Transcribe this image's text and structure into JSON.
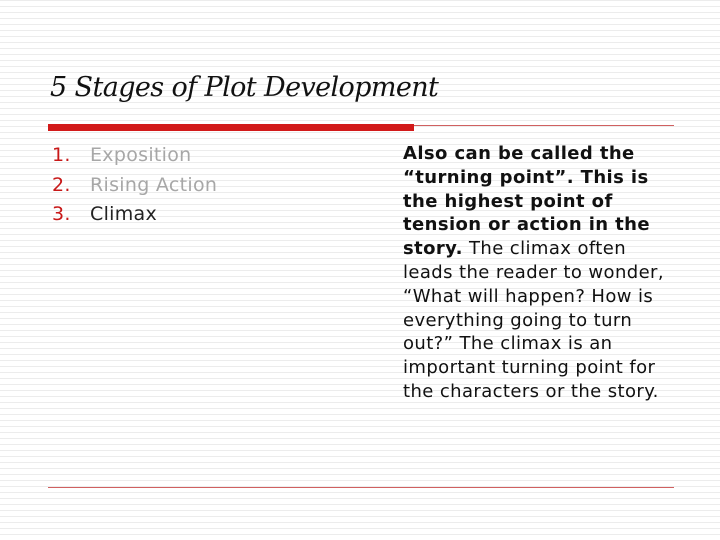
{
  "slide": {
    "title": "5 Stages of Plot Development",
    "list": [
      {
        "number": "1.",
        "label": "Exposition"
      },
      {
        "number": "2.",
        "label": "Rising Action"
      },
      {
        "number": "3.",
        "label": "Climax"
      }
    ],
    "description": {
      "bold": "Also can be called the “turning point”. This is the highest point of tension or action in the story.",
      "normal": " The climax often leads the reader to wonder, “What will happen? How is everything going to turn out?” The climax is an important turning point for the characters or the story."
    },
    "colors": {
      "accent_red": "#d21a1a",
      "muted_text": "#a7a7a7",
      "active_text": "#222222"
    }
  }
}
